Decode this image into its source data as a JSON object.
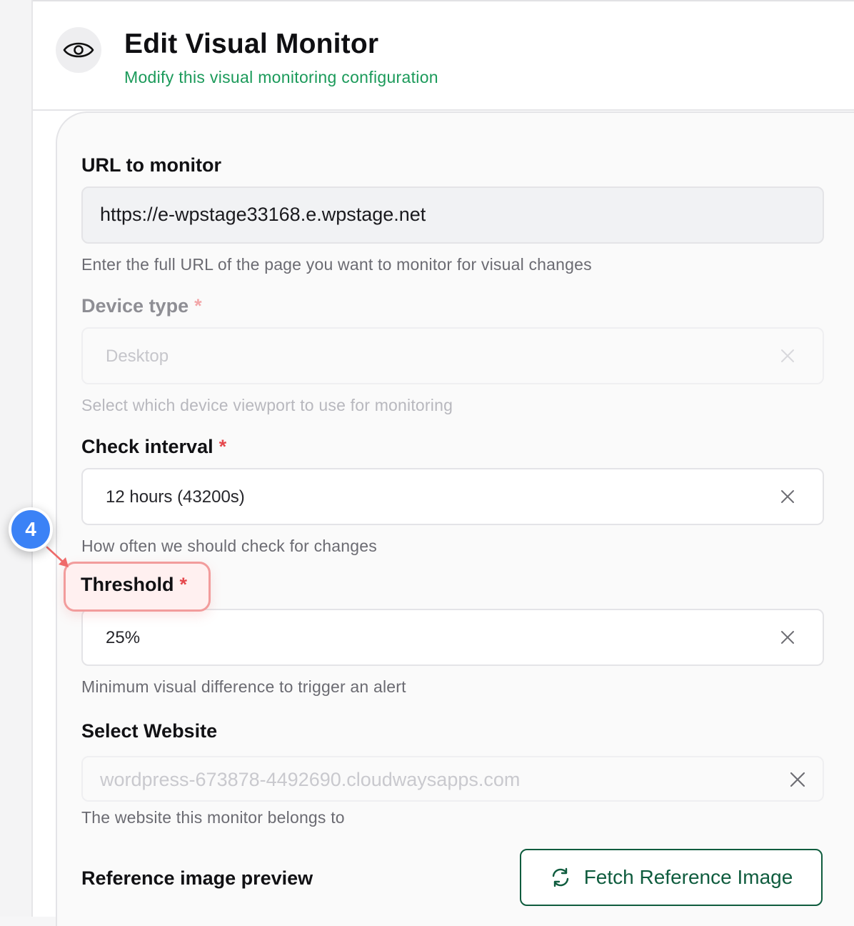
{
  "header": {
    "icon": "eye-icon",
    "title": "Edit Visual Monitor",
    "subtitle": "Modify this visual monitoring configuration"
  },
  "form": {
    "url": {
      "label": "URL to monitor",
      "value": "https://e-wpstage33168.e.wpstage.net",
      "help": "Enter the full URL of the page you want to monitor for visual changes"
    },
    "device_type": {
      "label": "Device type",
      "required_mark": "*",
      "value": "Desktop",
      "help": "Select which device viewport to use for monitoring",
      "disabled": true
    },
    "check_interval": {
      "label": "Check interval",
      "required_mark": "*",
      "value": "12 hours (43200s)",
      "help": "How often we should check for changes"
    },
    "threshold": {
      "label": "Threshold",
      "required_mark": "*",
      "value": "25%",
      "help": "Minimum visual difference to trigger an alert"
    },
    "website": {
      "label": "Select Website",
      "value": "wordpress-673878-4492690.cloudwaysapps.com",
      "help": "The website this monitor belongs to"
    },
    "reference": {
      "label": "Reference image preview",
      "button_label": "Fetch Reference Image",
      "button_icon": "refresh-icon"
    }
  },
  "annotation": {
    "step_number": "4",
    "badge_color": "#3b82f6",
    "highlight_color": "#f29c9c"
  },
  "colors": {
    "accent_green": "#1b9a5a",
    "button_green": "#0f5c3e",
    "required_red": "#e5484d"
  }
}
